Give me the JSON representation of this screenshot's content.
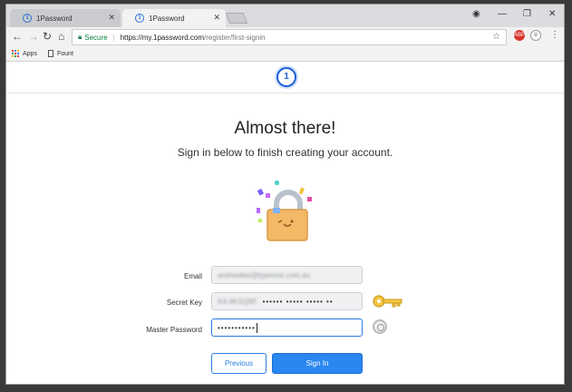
{
  "browser": {
    "tabs": [
      {
        "label": "1Password",
        "favicon": "1password-icon"
      },
      {
        "label": "1Password",
        "favicon": "1password-icon"
      }
    ],
    "secure_label": "Secure",
    "url_host": "https://my.1password.com",
    "url_path": "/register/first-signin",
    "bookmarks": [
      {
        "label": "Apps",
        "icon": "apps-grid-icon"
      },
      {
        "label": "Fount",
        "icon": "document-icon"
      }
    ],
    "extensions": [
      {
        "label": "ABP",
        "color": "#d9342b"
      }
    ]
  },
  "page": {
    "title": "Almost there!",
    "subtitle": "Sign in below to finish creating your account.",
    "form": {
      "email_label": "Email",
      "email_value": "andrewlee@typeone.com.au",
      "secret_key_label": "Secret Key",
      "secret_key_prefix": "A3-4KSQ9E",
      "secret_key_dots": "•••••• ••••• ••••• ••",
      "master_password_label": "Master Password",
      "master_password_dots": "•••••••••••"
    },
    "buttons": {
      "previous": "Previous",
      "sign_in": "Sign In"
    }
  },
  "colors": {
    "accent": "#2a86f0",
    "secure_green": "#0b8043"
  }
}
